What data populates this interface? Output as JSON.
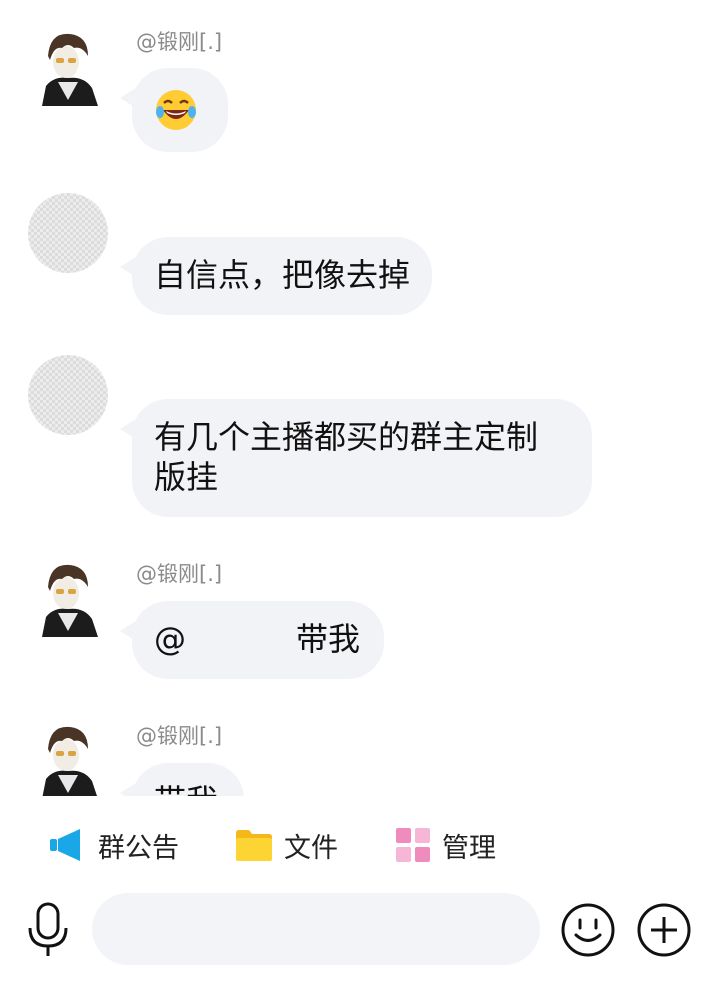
{
  "messages": [
    {
      "sender": "@锻刚[.]",
      "content_type": "emoji",
      "emoji": "face-with-tears-of-joy"
    },
    {
      "sender": "",
      "text": "自信点，把像去掉"
    },
    {
      "sender": "",
      "text_line1": "有几个主播都买的群主定制",
      "text_line2": "版挂"
    },
    {
      "sender": "@锻刚[.]",
      "text_at": "@",
      "text_tail": "带我"
    },
    {
      "sender": "@锻刚[.]",
      "text": "带我"
    }
  ],
  "toolbar": {
    "announcement_label": "群公告",
    "files_label": "文件",
    "manage_label": "管理"
  },
  "input": {
    "value": "",
    "placeholder": ""
  },
  "colors": {
    "bubble": "#f2f3f7",
    "announcement_icon": "#1aa7e8",
    "folder_icon": "#f7c520",
    "manage_icon": "#f08bbd"
  },
  "icons": [
    "megaphone-icon",
    "folder-icon",
    "grid-icon",
    "microphone-icon",
    "smiley-icon",
    "plus-icon"
  ]
}
